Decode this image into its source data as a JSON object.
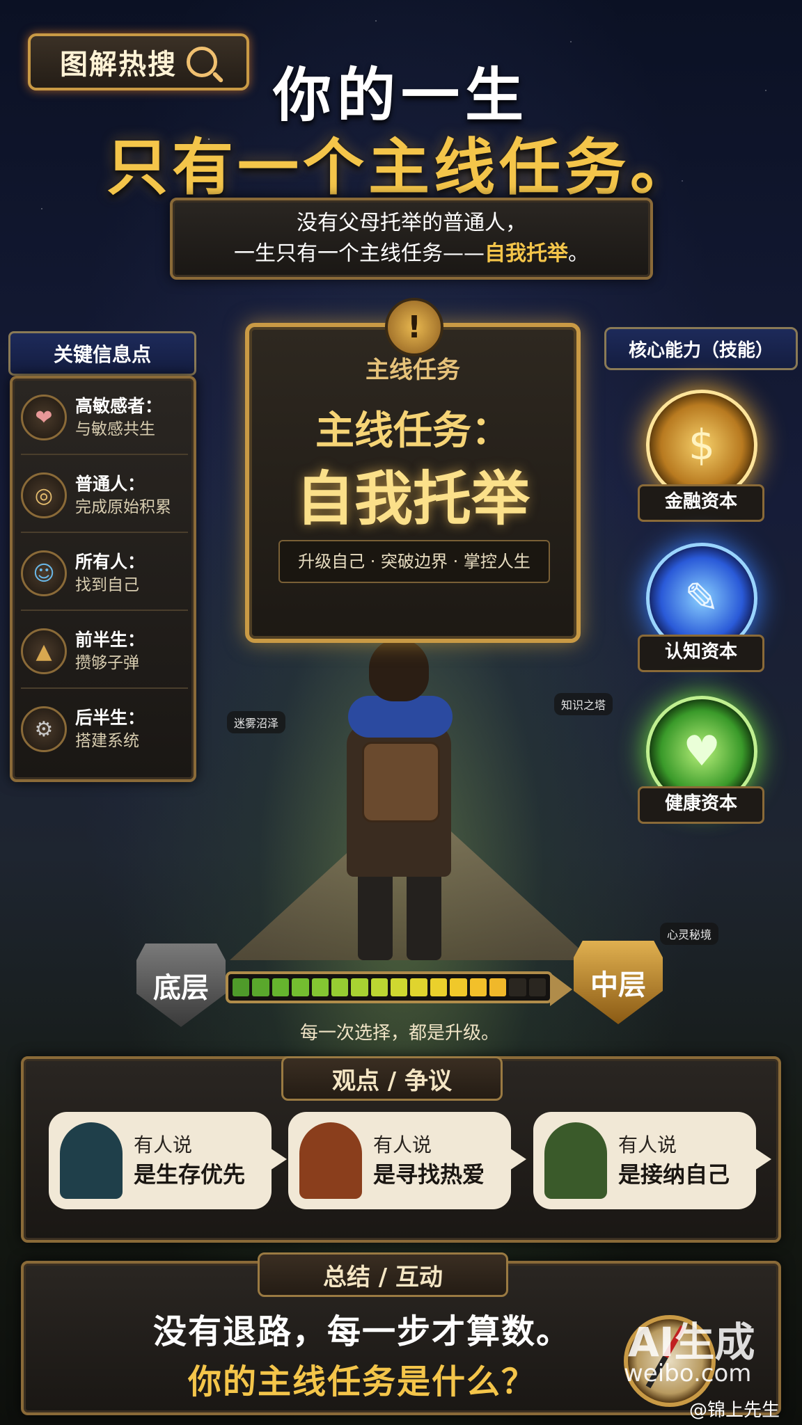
{
  "badge": {
    "label": "图解热搜",
    "icon": "magnifier-icon"
  },
  "title": {
    "line1": "你的一生",
    "line2": "只有一个主线任务。"
  },
  "subtitle": {
    "line1": "没有父母托举的普通人，",
    "line2_prefix": "一生只有一个主线任务——",
    "line2_highlight": "自我托举",
    "line2_suffix": "。"
  },
  "key_points": {
    "heading": "关键信息点",
    "items": [
      {
        "title": "高敏感者：",
        "desc": "与敏感共生",
        "icon": "heart-icon",
        "glyph": "❤"
      },
      {
        "title": "普通人：",
        "desc": "完成原始积累",
        "icon": "coins-icon",
        "glyph": "◎"
      },
      {
        "title": "所有人：",
        "desc": "找到自己",
        "icon": "person-icon",
        "glyph": "☺"
      },
      {
        "title": "前半生：",
        "desc": "攒够子弹",
        "icon": "bullet-icon",
        "glyph": "▲"
      },
      {
        "title": "后半生：",
        "desc": "搭建系统",
        "icon": "gear-icon",
        "glyph": "⚙"
      }
    ]
  },
  "quest": {
    "badge_glyph": "!",
    "label": "主线任务",
    "title1": "主线任务：",
    "title2": "自我托举",
    "tags": "升级自己 · 突破边界 · 掌控人生"
  },
  "skills": {
    "heading": "核心能力（技能）",
    "items": [
      {
        "label": "金融资本",
        "icon": "coins-chart-icon",
        "glyph": "$"
      },
      {
        "label": "认知资本",
        "icon": "book-lightbulb-icon",
        "glyph": "✎"
      },
      {
        "label": "健康资本",
        "icon": "heart-icon",
        "glyph": "♥"
      }
    ]
  },
  "map_labels": {
    "swamp": "迷雾沼泽",
    "tower": "知识之塔",
    "realm": "心灵秘境"
  },
  "progress": {
    "from": "底层",
    "to": "中层",
    "caption": "每一次选择，都是升级。",
    "filled": 0.85,
    "segment_colors": [
      "#4f9a2a",
      "#5aa82c",
      "#66b42e",
      "#74be30",
      "#84c632",
      "#96cc32",
      "#a8d232",
      "#bcd632",
      "#cfd830",
      "#e0d42e",
      "#ead02c",
      "#f0c82a",
      "#f2c02a",
      "#f0b82a"
    ]
  },
  "viewpoints": {
    "heading": "观点 / 争议",
    "items": [
      {
        "lead": "有人说",
        "text": "是生存优先",
        "avatar_color": "#1f3f4a"
      },
      {
        "lead": "有人说",
        "text": "是寻找热爱",
        "avatar_color": "#8a3e1c"
      },
      {
        "lead": "有人说",
        "text": "是接纳自己",
        "avatar_color": "#3a5a2a"
      }
    ]
  },
  "summary": {
    "heading": "总结 / 互动",
    "line1": "没有退路，每一步才算数。",
    "line2": "你的主线任务是什么？"
  },
  "watermark": {
    "ai": "AI生成",
    "url": "weibo.com",
    "user": "@锦上先生"
  }
}
